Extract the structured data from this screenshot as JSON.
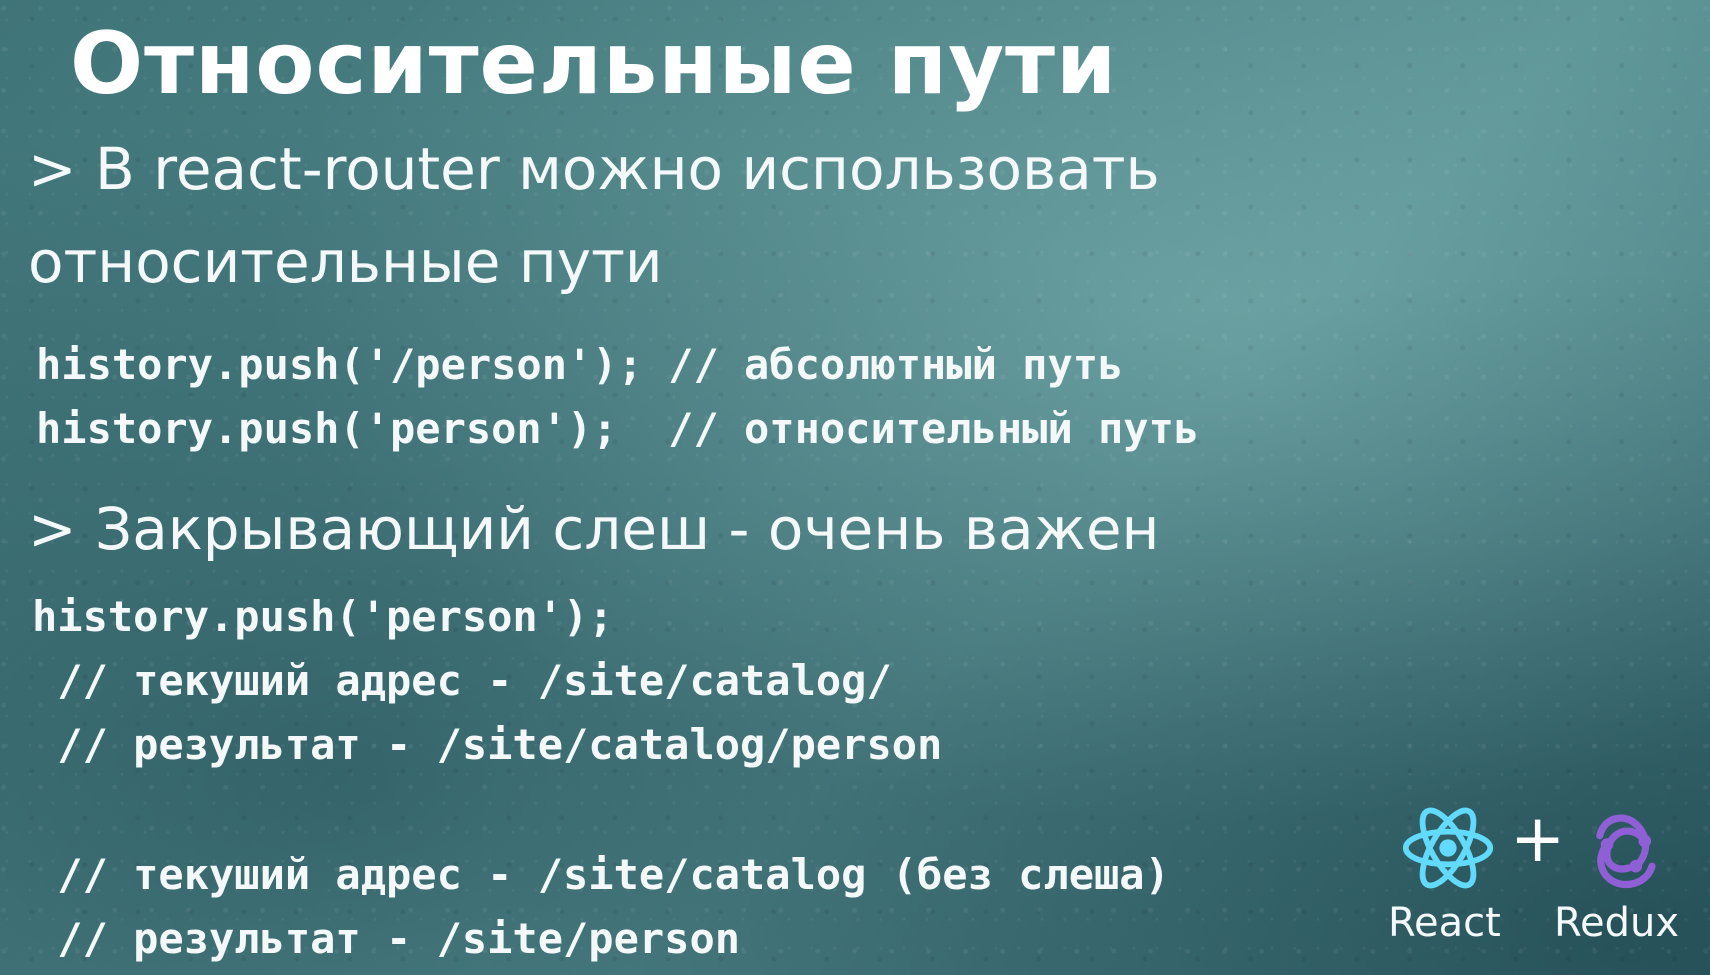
{
  "slide": {
    "title": "Относительные пути",
    "bullet1_line1": "> В react-router можно использовать",
    "bullet1_line2": "относительные пути",
    "code1": "history.push('/person'); // абсолютный путь",
    "code2": "history.push('person');  // относительный путь",
    "bullet2": "> Закрывающий слеш - очень важен",
    "code3": "history.push('person');",
    "code4": " // текуший адрес - /site/catalog/",
    "code5": " // результат - /site/catalog/person",
    "code6": " // текуший адрес - /site/catalog (без слеша)",
    "code7": " // результат - /site/person"
  },
  "logos": {
    "react_label": "React",
    "plus": "+",
    "redux_label": "Redux",
    "react_icon": "react-atom-icon",
    "redux_icon": "redux-icon",
    "react_color": "#61dafb",
    "redux_color": "#764abc"
  }
}
